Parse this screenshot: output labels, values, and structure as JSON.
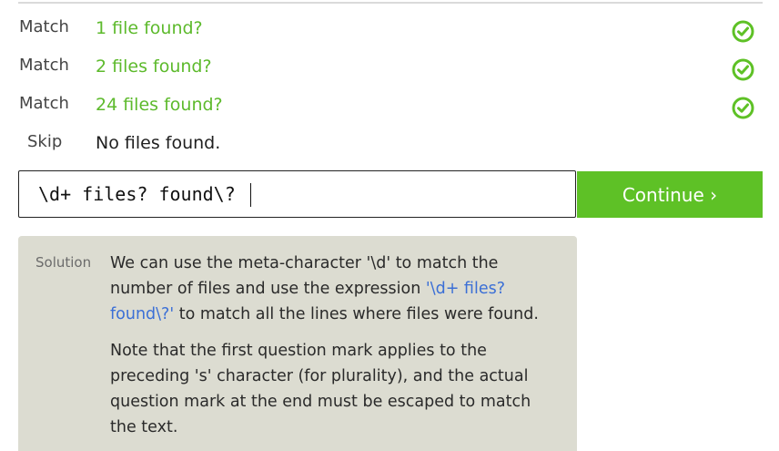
{
  "tasks": [
    {
      "type": "Match",
      "text": "1 file found?",
      "status": "check-circle-icon"
    },
    {
      "type": "Match",
      "text": "2 files found?",
      "status": "check-circle-icon"
    },
    {
      "type": "Match",
      "text": "24 files found?",
      "status": "check-circle-icon"
    },
    {
      "type": "Skip",
      "text": "No files found.",
      "status": ""
    }
  ],
  "input": {
    "value": "\\d+ files? found\\?"
  },
  "continue_label": "Continue ›",
  "solution": {
    "label": "Solution",
    "p1_before": "We can use the meta-character '\\d' to match the number of files and use the expression ",
    "p1_code": "'\\d+ files? found\\?'",
    "p1_after": " to match all the lines where files were found.",
    "p2": "Note that the first question mark applies to the preceding 's' character (for plurality), and the actual question mark at the end must be escaped to match the text."
  },
  "colors": {
    "accent_green": "#5ec126",
    "match_text": "#5dba2c",
    "code_blue": "#3b6fd6",
    "solution_bg": "#dcdcd1"
  }
}
